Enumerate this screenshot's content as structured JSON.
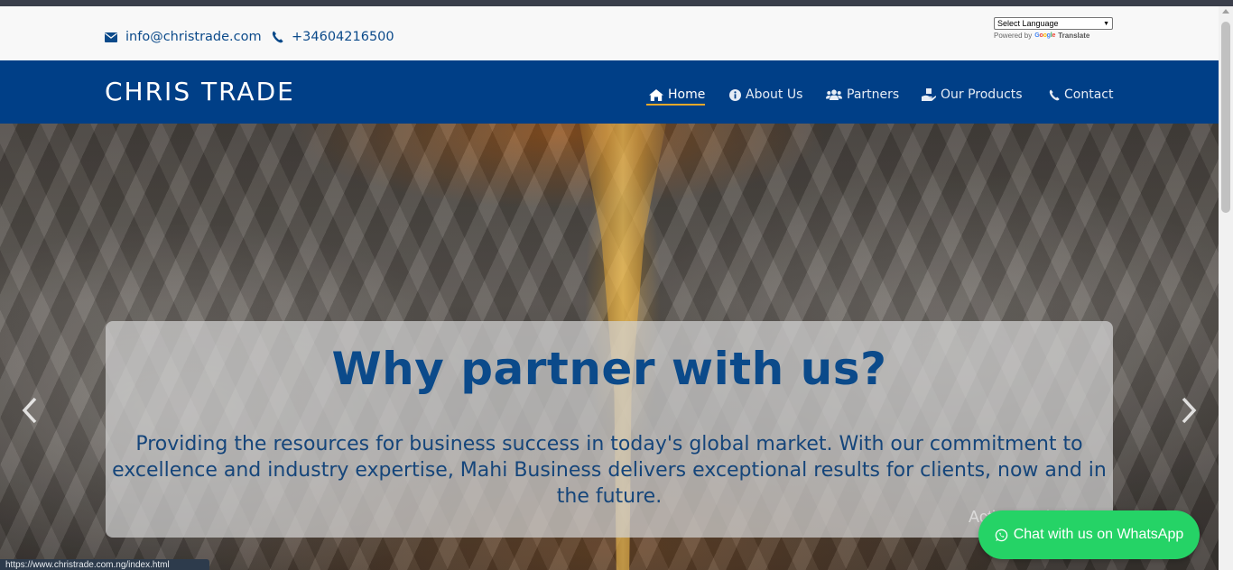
{
  "topbar": {
    "email": "info@christrade.com",
    "phone": "+34604216500",
    "translate": {
      "select_label": "Select Language",
      "powered_by": "Powered by",
      "google": "Google",
      "translate": "Translate"
    }
  },
  "navbar": {
    "brand": "CHRIS TRADE",
    "items": [
      {
        "label": "Home",
        "icon": "home-icon",
        "active": true
      },
      {
        "label": "About Us",
        "icon": "info-circle-icon",
        "active": false
      },
      {
        "label": "Partners",
        "icon": "users-icon",
        "active": false
      },
      {
        "label": "Our Products",
        "icon": "hand-box-icon",
        "active": false
      },
      {
        "label": "Contact",
        "icon": "phone-icon",
        "active": false
      }
    ]
  },
  "hero": {
    "title": "Why partner with us?",
    "text": "Providing the resources for business success in today's global market. With our commitment to excellence and industry expertise, Mahi Business delivers exceptional results for clients, now and in the future."
  },
  "status_url": "https://www.christrade.com.ng/index.html",
  "watermark": "Activate Windows",
  "whatsapp": {
    "label": "Chat with us on WhatsApp"
  },
  "colors": {
    "navbar": "#003f87",
    "accent": "#e8a92a",
    "link": "#0b4a8a",
    "whatsapp": "#25d366"
  }
}
